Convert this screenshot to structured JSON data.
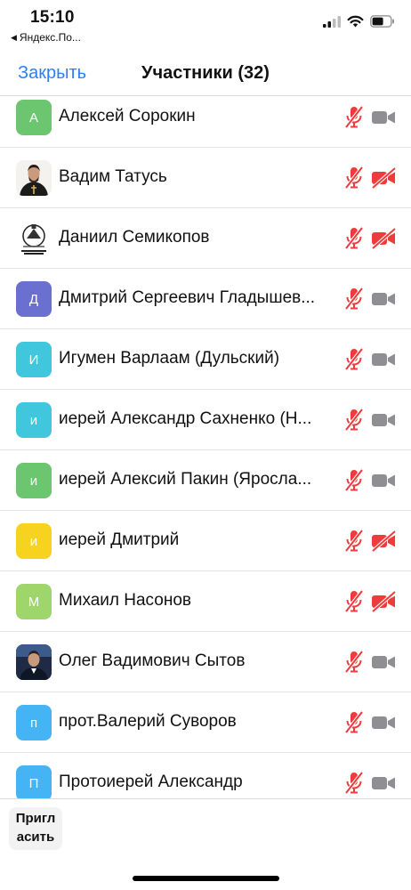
{
  "status_bar": {
    "time": "15:10",
    "back_app_label": "Яндекс.По..."
  },
  "header": {
    "close_label": "Закрыть",
    "title": "Участники (32)"
  },
  "participants": [
    {
      "name": "Алексей Сорокин",
      "avatar": {
        "type": "initial",
        "letter": "А",
        "color": "#6cc56f"
      },
      "mic_muted": true,
      "video_off": false
    },
    {
      "name": "Вадим Татусь",
      "avatar": {
        "type": "photo",
        "icon": "priest-photo"
      },
      "mic_muted": true,
      "video_off": true
    },
    {
      "name": "Даниил Семикопов",
      "avatar": {
        "type": "photo",
        "icon": "emblem-logo"
      },
      "mic_muted": true,
      "video_off": true
    },
    {
      "name": "Дмитрий Сергеевич Гладышев...",
      "avatar": {
        "type": "initial",
        "letter": "Д",
        "color": "#6a6fd0"
      },
      "mic_muted": true,
      "video_off": false
    },
    {
      "name": "Игумен Варлаам (Дульский)",
      "avatar": {
        "type": "initial",
        "letter": "И",
        "color": "#40c7dd"
      },
      "mic_muted": true,
      "video_off": false
    },
    {
      "name": "иерей Александр Сахненко (Н...",
      "avatar": {
        "type": "initial",
        "letter": "и",
        "color": "#40c7dd"
      },
      "mic_muted": true,
      "video_off": false
    },
    {
      "name": "иерей Алексий Пакин (Яросла...",
      "avatar": {
        "type": "initial",
        "letter": "и",
        "color": "#6cc56f"
      },
      "mic_muted": true,
      "video_off": false
    },
    {
      "name": "иерей Дмитрий",
      "avatar": {
        "type": "initial",
        "letter": "и",
        "color": "#f7d320"
      },
      "mic_muted": true,
      "video_off": true
    },
    {
      "name": "Михаил Насонов",
      "avatar": {
        "type": "initial",
        "letter": "М",
        "color": "#9fd66c"
      },
      "mic_muted": true,
      "video_off": true
    },
    {
      "name": "Олег Вадимович Сытов",
      "avatar": {
        "type": "photo",
        "icon": "person-photo"
      },
      "mic_muted": true,
      "video_off": false
    },
    {
      "name": "прот.Валерий Суворов",
      "avatar": {
        "type": "initial",
        "letter": "п",
        "color": "#45b4f4"
      },
      "mic_muted": true,
      "video_off": false
    },
    {
      "name": "Протоиерей Александр",
      "avatar": {
        "type": "initial",
        "letter": "П",
        "color": "#45b4f4"
      },
      "mic_muted": true,
      "video_off": false
    }
  ],
  "footer": {
    "invite_label": "Пригл асить"
  },
  "colors": {
    "accent": "#2d7ff9",
    "muted_red": "#ef3b3b",
    "video_gray": "#8e8e93"
  }
}
